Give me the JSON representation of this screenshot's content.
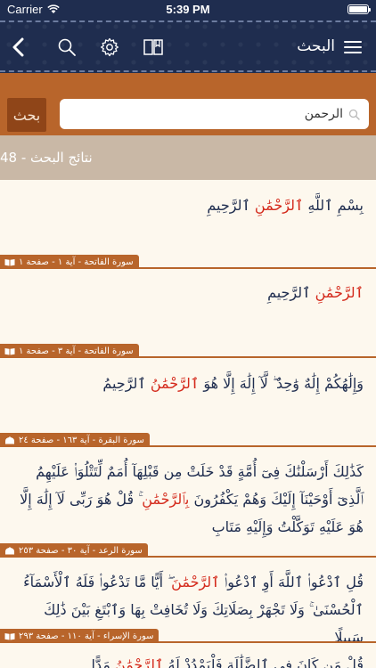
{
  "status_bar": {
    "carrier": "Carrier",
    "time": "5:39 PM"
  },
  "nav": {
    "title": "البحث",
    "icons": [
      "back-chevron-icon",
      "search-icon",
      "gear-icon",
      "book-icon",
      "menu-icon"
    ]
  },
  "search": {
    "button_label": "بحث",
    "value": "الرحمن",
    "icon": "search-icon"
  },
  "results_header": "نتائج البحث - 48",
  "results": [
    {
      "before": "بِسْمِ ٱللَّهِ ",
      "highlight": "ٱلرَّحْمَٰنِ",
      "after": " ٱلرَّحِيمِ",
      "reference": "سورة الفاتحة - آية ١ - صفحة ١"
    },
    {
      "before": "",
      "highlight": "ٱلرَّحْمَٰنِ",
      "after": " ٱلرَّحِيمِ",
      "reference": "سورة الفاتحة - آية ٣ - صفحة ١"
    },
    {
      "before": "وَإِلَٰهُكُمْ إِلَٰهٌ وَٰحِدٌ ۖ لَّآ إِلَٰهَ إِلَّا هُوَ ",
      "highlight": "ٱلرَّحْمَٰنُ",
      "after": " ٱلرَّحِيمُ",
      "reference": "سورة البقرة - آية ١٦٣ - صفحة ٢٤"
    },
    {
      "before": "كَذَٰلِكَ أَرْسَلْنَٰكَ فِىٓ أُمَّةٍ قَدْ خَلَتْ مِن قَبْلِهَآ أُمَمٌ لِّتَتْلُوَا۟ عَلَيْهِمُ ٱلَّذِىٓ أَوْحَيْنَآ إِلَيْكَ وَهُمْ يَكْفُرُونَ ",
      "highlight": "بِٱلرَّحْمَٰنِ",
      "after": " ۚ قُلْ هُوَ رَبِّى لَآ إِلَٰهَ إِلَّا هُوَ عَلَيْهِ تَوَكَّلْتُ وَإِلَيْهِ مَتَابِ",
      "reference": "سورة الرعد - آية ٣٠ - صفحة ٢٥٣"
    },
    {
      "before": "قُلِ ٱدْعُوا۟ ٱللَّهَ أَوِ ٱدْعُوا۟ ",
      "highlight": "ٱلرَّحْمَٰنَ",
      "after": " ۖ أَيًّا مَّا تَدْعُوا۟ فَلَهُ ٱلْأَسْمَآءُ ٱلْحُسْنَىٰ ۚ وَلَا تَجْهَرْ بِصَلَاتِكَ وَلَا تُخَافِتْ بِهَا وَٱبْتَغِ بَيْنَ ذَٰلِكَ سَبِيلًا",
      "reference": "سورة الإسراء - آية ١١٠ - صفحة ٢٩٣"
    },
    {
      "before": "قُلْ مَن كَانَ فِى ٱلضَّلَٰلَةِ فَلْيَمْدُدْ لَهُ ",
      "highlight": "ٱلرَّحْمَٰنُ",
      "after": " مَدًّا",
      "reference": ""
    }
  ]
}
